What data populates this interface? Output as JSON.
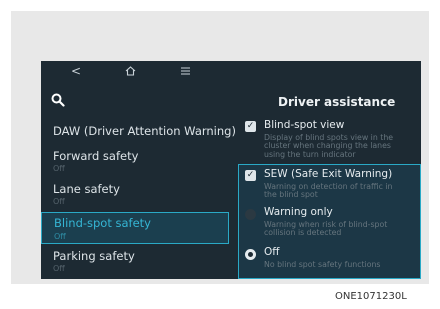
{
  "topbar": {
    "back_icon": "chevron-left-icon",
    "home_icon": "home-icon",
    "menu_icon": "menu-icon"
  },
  "left_menu": [
    {
      "label": "DAW (Driver Attention Warning)",
      "sub": ""
    },
    {
      "label": "Forward safety",
      "sub": "Off"
    },
    {
      "label": "Lane safety",
      "sub": "Off"
    },
    {
      "label": "Blind-spot safety",
      "sub": "Off",
      "selected": true
    },
    {
      "label": "Parking safety",
      "sub": "Off"
    }
  ],
  "right_panel": {
    "title": "Driver assistance",
    "blind_spot_view": {
      "label": "Blind-spot view",
      "desc": "Display of blind spots view in the cluster when changing the lanes using the turn indicator",
      "checked": true
    },
    "sew": {
      "label": "SEW (Safe Exit Warning)",
      "desc": "Warning on detection of traffic in the blind spot",
      "checked": true
    },
    "warning_only": {
      "label": "Warning only",
      "desc": "Warning when risk of blind-spot collision is detected"
    },
    "off": {
      "label": "Off",
      "desc": "No blind spot safety functions"
    }
  },
  "caption": "ONE1071230L",
  "colors": {
    "screen_bg": "#1d2a33",
    "accent": "#2aa9c6"
  }
}
